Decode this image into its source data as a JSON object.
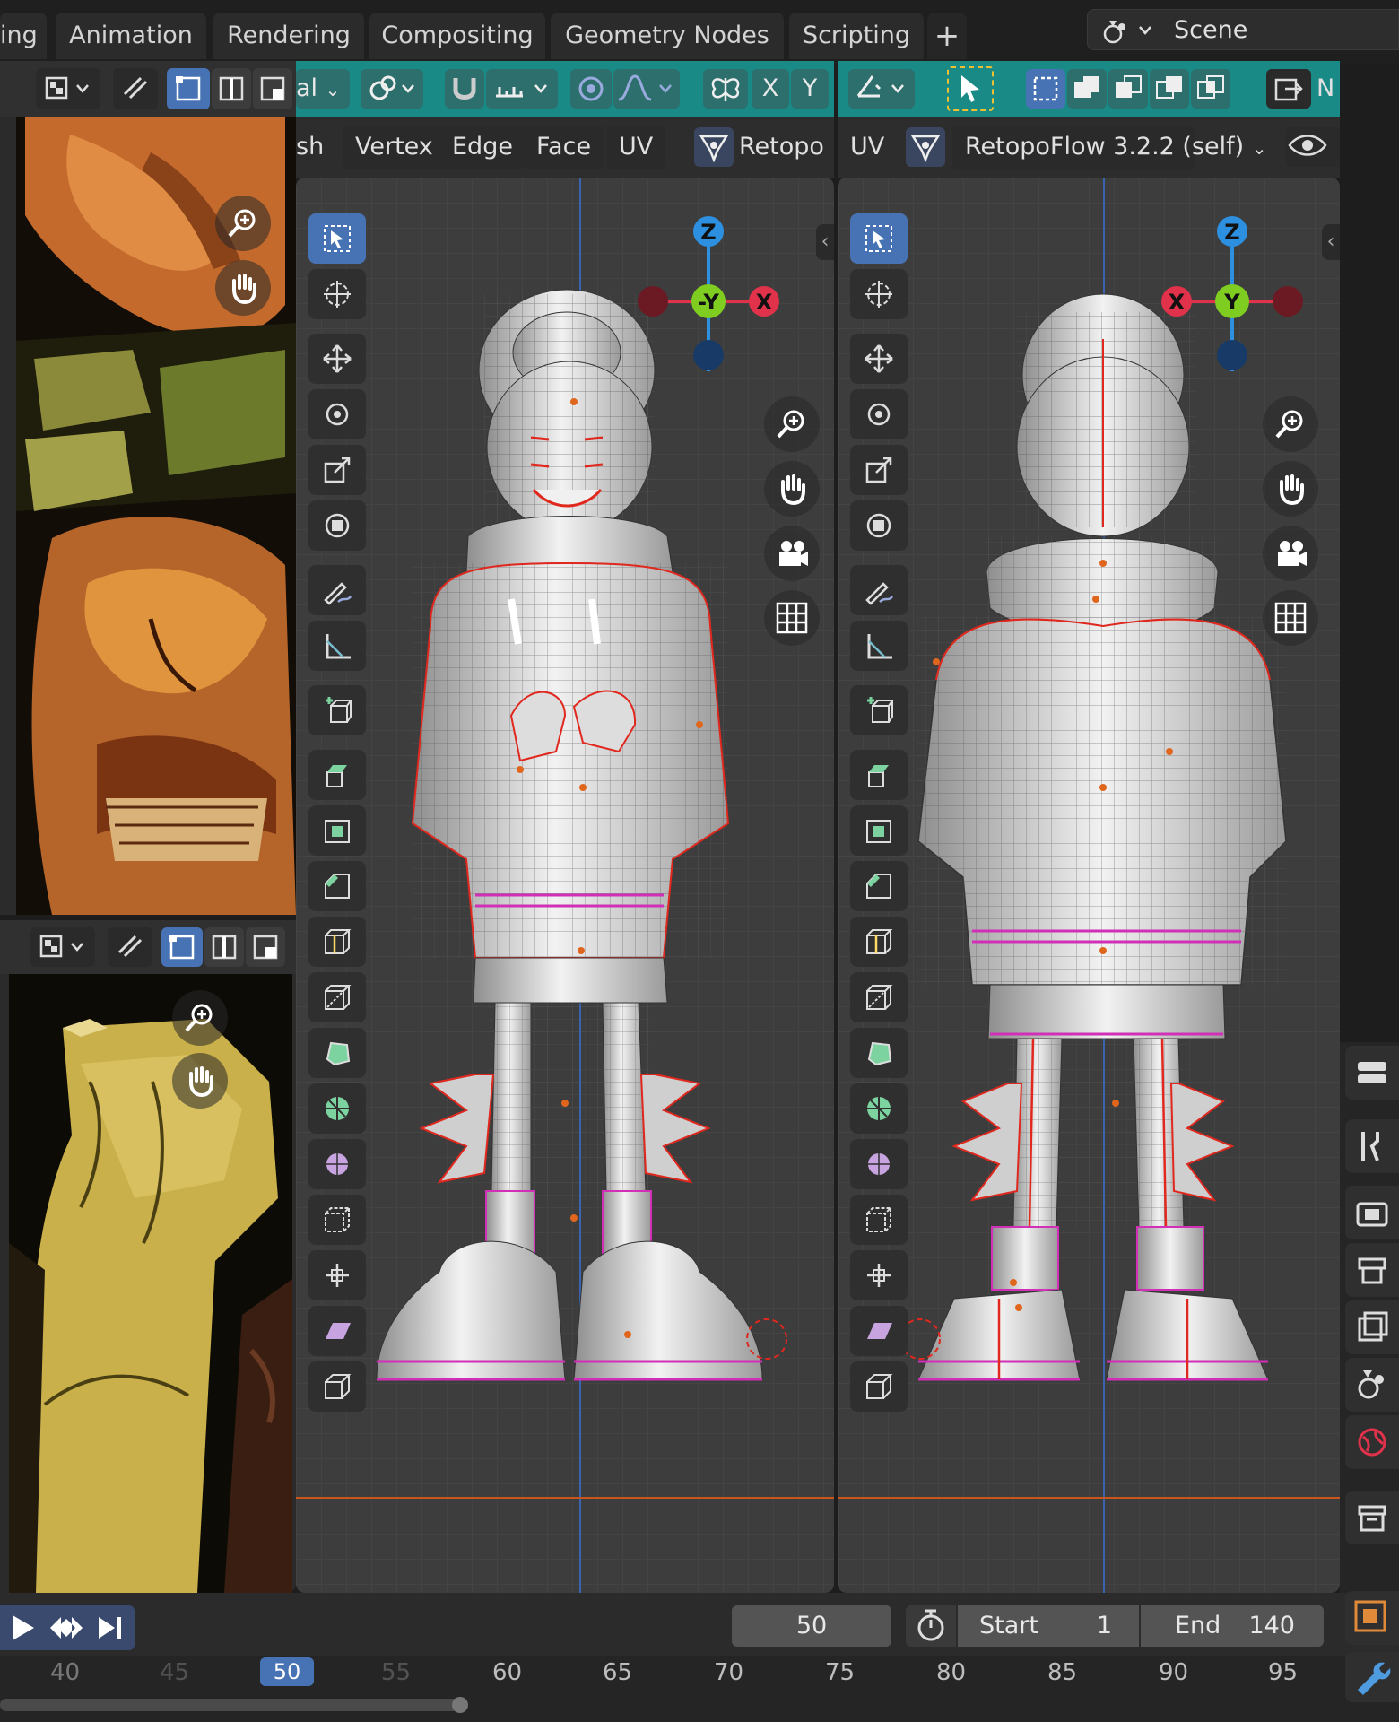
{
  "workspace_tabs": [
    "ing",
    "Animation",
    "Rendering",
    "Compositing",
    "Geometry Nodes",
    "Scripting"
  ],
  "add_tab_symbol": "+",
  "scene": {
    "name": "Scene"
  },
  "left_viewport": {
    "header_left": "al",
    "axis_buttons": [
      "X",
      "Y"
    ],
    "menus": [
      "sh",
      "Vertex",
      "Edge",
      "Face",
      "UV"
    ],
    "addon_label": "Retopo",
    "gizmo": {
      "top": "Z",
      "center": "-Y",
      "right": "X"
    }
  },
  "right_viewport": {
    "header_right": "N",
    "menus": [
      "UV"
    ],
    "addon_label": "RetopoFlow 3.2.2 (self)",
    "gizmo": {
      "top": "Z",
      "center": "Y",
      "left": "X"
    }
  },
  "timeline": {
    "current_frame": "50",
    "start_label": "Start",
    "start_value": "1",
    "end_label": "End",
    "end_value": "140",
    "ruler": [
      "40",
      "45",
      "50",
      "55",
      "60",
      "65",
      "70",
      "75",
      "80",
      "85",
      "90",
      "95"
    ],
    "current_marker": "50"
  },
  "colors": {
    "header_teal": "#1a8a87",
    "active_blue": "#4772b3",
    "axis_x": "#e0324a",
    "axis_y": "#7fcd21",
    "axis_z": "#2c8fe0",
    "mesh_seam_red": "#e0281e",
    "edge_magenta": "#d22fb8"
  },
  "icons": [
    "search-icon",
    "hand-icon",
    "camera-icon",
    "grid-icon",
    "scene-icon",
    "wrench-icon",
    "world-icon",
    "render-icon",
    "output-icon",
    "view-layer-icon",
    "tool-icon",
    "play-icon",
    "jump-keyframe-icon",
    "jump-end-icon",
    "stopwatch-icon"
  ]
}
